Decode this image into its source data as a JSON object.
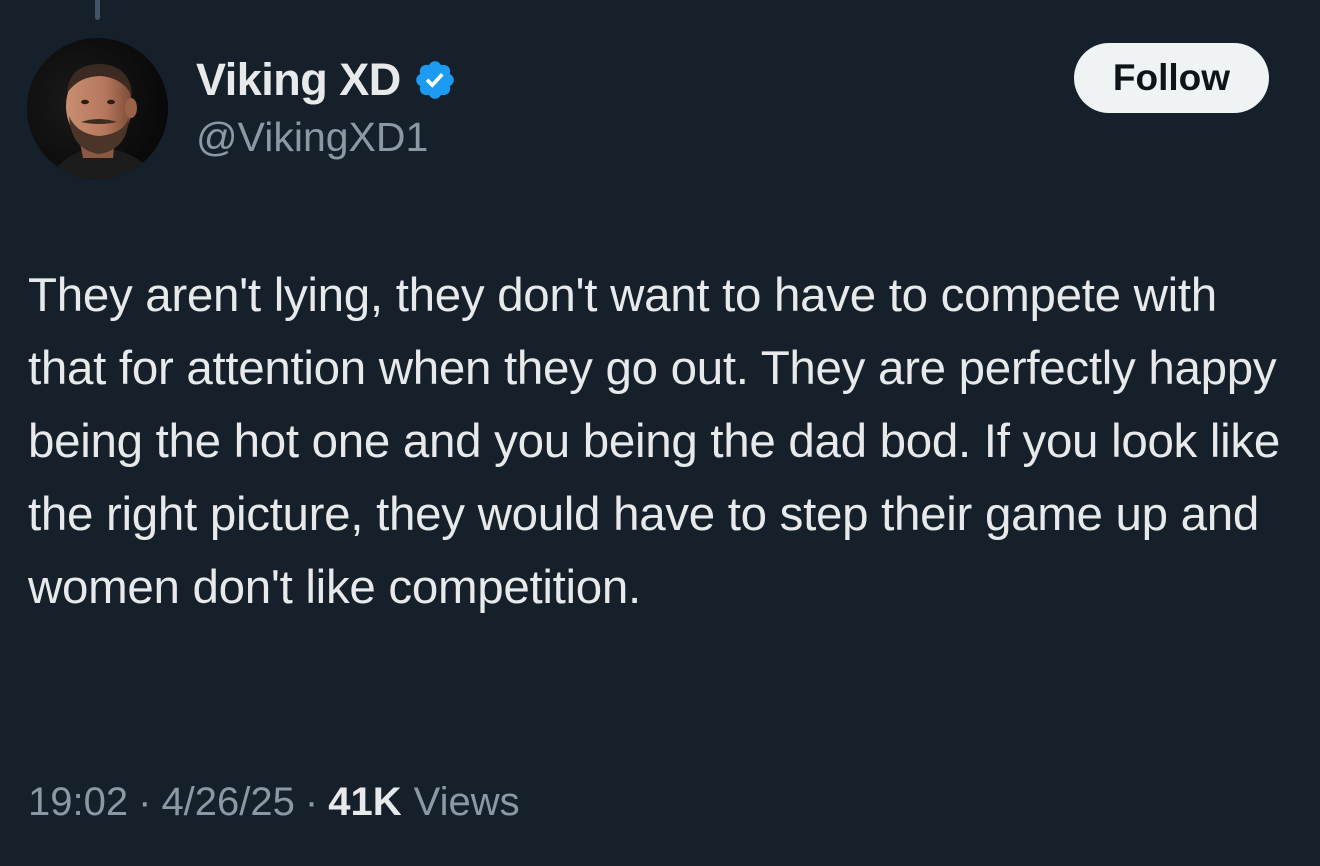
{
  "author": {
    "display_name": "Viking XD",
    "handle": "@VikingXD1",
    "verified": true,
    "avatar_icon": "user-avatar-photo"
  },
  "follow_button": {
    "label": "Follow"
  },
  "tweet": {
    "text": "They aren't lying, they don't want to have to compete with that for attention when they go out. They are perfectly happy being the hot one and you being the dad bod. If you look like the right picture, they would have to step their game up and women don't like competition."
  },
  "meta": {
    "time": "19:02",
    "date": "4/26/25",
    "separator": "·",
    "views_count": "41K",
    "views_label": "Views"
  },
  "colors": {
    "background": "#15202b",
    "text_primary": "#e7e9ea",
    "text_secondary": "#8b98a5",
    "verified_badge": "#1d9bf0",
    "follow_button_bg": "#eff3f4"
  }
}
